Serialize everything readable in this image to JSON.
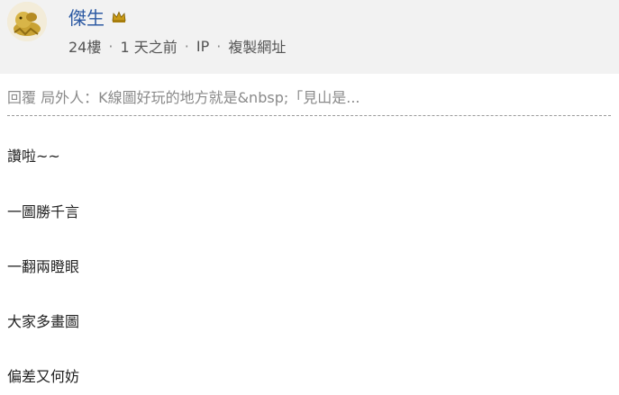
{
  "post": {
    "author": {
      "name": "傑生",
      "badge_icon": "crown-icon"
    },
    "meta": {
      "floor": "24樓",
      "time": "1 天之前",
      "ip": "IP",
      "copy_link": "複製網址"
    },
    "reply_quote": "回覆 局外人：K線圖好玩的地方就是&nbsp;「見山是...",
    "content_lines": [
      "讚啦~~",
      "一圖勝千言",
      "一翻兩瞪眼",
      "大家多畫圖",
      "偏差又何妨"
    ]
  },
  "colors": {
    "header_bg": "#f2f2f2",
    "username": "#2d5aa3",
    "quote_text": "#8a8a8a"
  }
}
